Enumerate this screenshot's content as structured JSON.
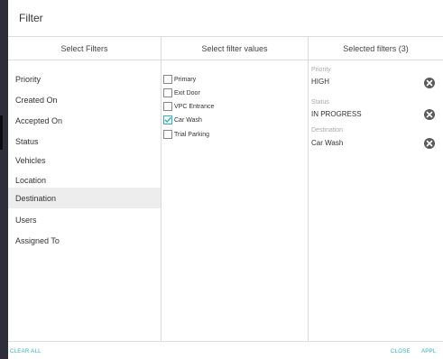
{
  "dialog": {
    "title": "Filter"
  },
  "columns": {
    "select_filters": "Select Filters",
    "select_values": "Select filter values",
    "selected": "Selected filters (3)"
  },
  "filters": [
    "Priority",
    "Created On",
    "Accepted On",
    "Status",
    "Vehicles",
    "Location",
    "Destination",
    "Users",
    "Assigned To"
  ],
  "active_filter": "Destination",
  "values": [
    {
      "label": "Primary",
      "checked": false
    },
    {
      "label": "Exit Door",
      "checked": false
    },
    {
      "label": "VPC Entrance",
      "checked": false
    },
    {
      "label": "Car Wash",
      "checked": true
    },
    {
      "label": "Trial Parking",
      "checked": false
    }
  ],
  "selected": [
    {
      "category": "Priority",
      "value": "HIGH"
    },
    {
      "category": "Status",
      "value": "IN PROGRESS"
    },
    {
      "category": "Destination",
      "value": "Car Wash"
    }
  ],
  "footer": {
    "clear_all": "CLEAR ALL",
    "close": "CLOSE",
    "apply": "APPL"
  },
  "colors": {
    "accent": "#2bb3c0",
    "active_row": "#ededed",
    "remove_icon_bg": "#5a5a5a"
  }
}
